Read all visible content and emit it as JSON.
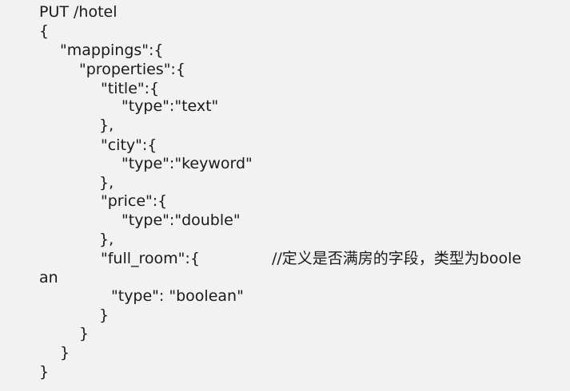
{
  "code": {
    "lines": [
      "PUT /hotel",
      "{",
      "\"mappings\":{",
      "\"properties\":{",
      "\"title\":{",
      "\"type\":\"text\"",
      "},",
      "\"city\":{",
      "\"type\":\"keyword\"",
      "},",
      "\"price\":{",
      "\"type\":\"double\"",
      "},",
      "\"full_room\":{",
      "//定义是否满房的字段，类型为boole",
      "an",
      "\"type\": \"boolean\"",
      "}",
      "}",
      "}",
      "}"
    ]
  }
}
